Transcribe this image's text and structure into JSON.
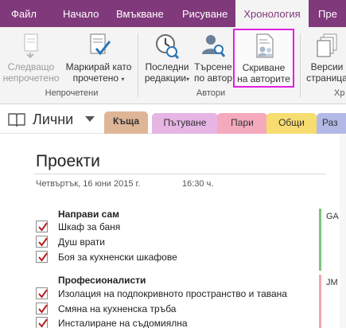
{
  "ribbon_tabs": [
    "Файл",
    "Начало",
    "Вмъкване",
    "Рисуване",
    "Хронология",
    "Пре"
  ],
  "active_tab": "Хронология",
  "ribbon": {
    "groups": [
      {
        "label": "Непрочетени",
        "buttons": [
          {
            "label_line1": "Следващо",
            "label_line2": "непрочетено",
            "icon": "next-unread-icon",
            "enabled": false
          },
          {
            "label_line1": "Маркирай като",
            "label_line2": "прочетено",
            "icon": "mark-as-read-icon",
            "dropdown": true,
            "enabled": true
          }
        ]
      },
      {
        "label": "Автори",
        "buttons": [
          {
            "label_line1": "Последни",
            "label_line2": "редакции",
            "icon": "recent-edits-icon",
            "dropdown": true,
            "enabled": true
          },
          {
            "label_line1": "Търсене",
            "label_line2": "по автор",
            "icon": "find-by-author-icon",
            "enabled": true
          },
          {
            "label_line1": "Скриване",
            "label_line2": "на авторите",
            "icon": "hide-authors-icon",
            "enabled": true,
            "highlighted": true
          }
        ]
      },
      {
        "label": "Хр",
        "buttons": [
          {
            "label_line1": "Версии",
            "label_line2": "страница",
            "icon": "page-versions-icon",
            "enabled": true
          }
        ]
      }
    ],
    "dropdown_caret": "▾"
  },
  "notebook": {
    "name": "Лични",
    "icon": "notebook-icon"
  },
  "section_tabs": [
    {
      "label": "Къща",
      "color": "#dfb597",
      "active": true
    },
    {
      "label": "Пътуване",
      "color": "#e6b5e4"
    },
    {
      "label": "Пари",
      "color": "#f5a9bd"
    },
    {
      "label": "Общи",
      "color": "#f7dc70"
    },
    {
      "label": "Раз",
      "color": "#b2b9e6"
    }
  ],
  "page": {
    "title": "Проекти",
    "date": "Четвъртък, 16 юни 2015 г.",
    "time": "16:30 ч."
  },
  "lists": [
    {
      "heading": "Направи сам",
      "items": [
        "Шкаф за баня",
        "Душ врати",
        "Боя за кухненски шкафове"
      ],
      "author": "GA",
      "author_color": "#7cc47f"
    },
    {
      "heading": "Професионалисти",
      "items": [
        "Изолация на подпокривното пространство и тавана",
        "Смяна на кухненска тръба",
        "Инсталиране на съдомиялна"
      ],
      "author": "JM",
      "author_color": "#f2a5ae"
    }
  ],
  "colors": {
    "ribbon_tab_bar": "#80397b",
    "ribbon_body": "#f4f4f4",
    "highlight_border": "#e020e0",
    "checkmark": "#b22020"
  }
}
